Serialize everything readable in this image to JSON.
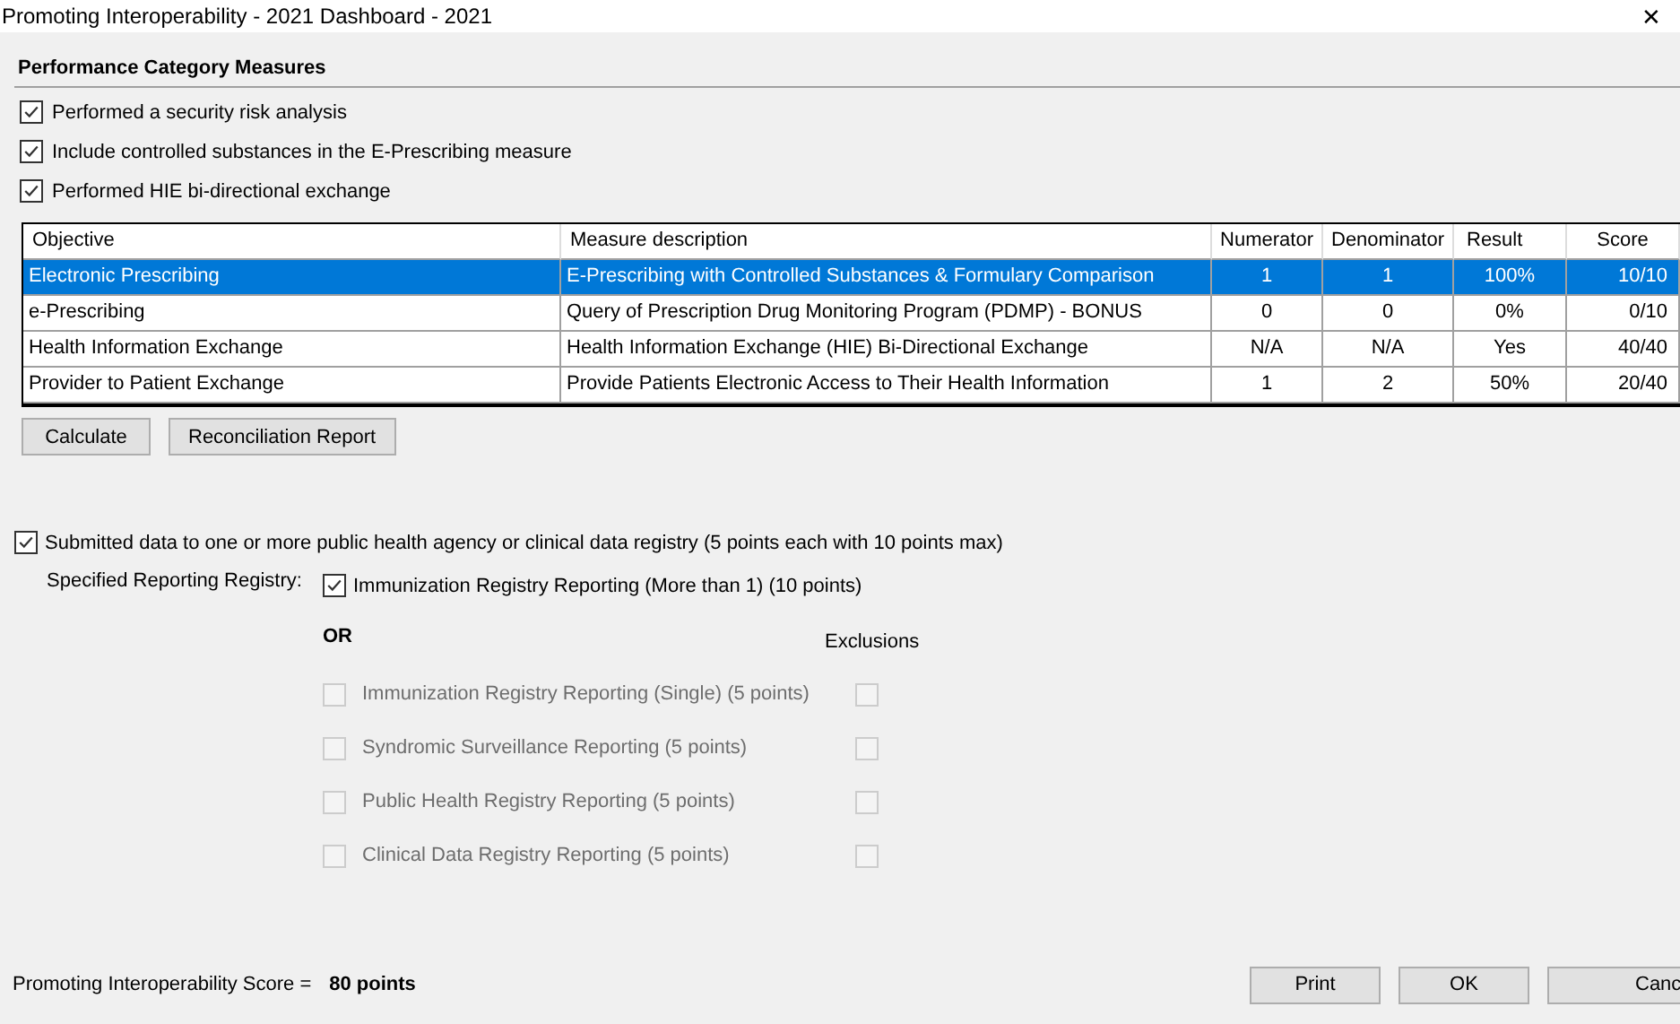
{
  "window": {
    "title": "Promoting Interoperability - 2021 Dashboard - 2021",
    "close": "✕"
  },
  "section_title": "Performance Category Measures",
  "options": [
    {
      "label": "Performed a security risk analysis",
      "checked": true
    },
    {
      "label": "Include controlled substances in the E-Prescribing measure",
      "checked": true
    },
    {
      "label": "Performed HIE bi-directional exchange",
      "checked": true
    }
  ],
  "table": {
    "columns": [
      "Objective",
      "Measure description",
      "Numerator",
      "Denominator",
      "Result",
      "Score"
    ],
    "rows": [
      {
        "cells": [
          "Electronic Prescribing",
          "E-Prescribing with Controlled Substances & Formulary Comparison",
          "1",
          "1",
          "100%",
          "10/10"
        ],
        "selected": true
      },
      {
        "cells": [
          "e-Prescribing",
          "Query of Prescription Drug Monitoring Program (PDMP) - BONUS",
          "0",
          "0",
          "0%",
          "0/10"
        ],
        "selected": false
      },
      {
        "cells": [
          "Health Information Exchange",
          "Health Information Exchange (HIE) Bi-Directional Exchange",
          "N/A",
          "N/A",
          "Yes",
          "40/40"
        ],
        "selected": false
      },
      {
        "cells": [
          "Provider to Patient Exchange",
          "Provide Patients Electronic Access to Their Health Information",
          "1",
          "2",
          "50%",
          "20/40"
        ],
        "selected": false
      }
    ]
  },
  "table_buttons": [
    "Calculate",
    "Reconciliation Report"
  ],
  "public_health": {
    "label": "Submitted data to one or more public health agency or clinical data registry  (5 points each with 10 points max)",
    "checked": true
  },
  "registry_label": "Specified Reporting Registry:",
  "primary_registry": {
    "label": "Immunization Registry Reporting (More than 1) (10 points)",
    "checked": true,
    "disabled": false
  },
  "or_label": "OR",
  "exclusions_label": "Exclusions",
  "registry_options": [
    {
      "label": "Immunization Registry Reporting (Single) (5 points)",
      "checked": false,
      "disabled": true,
      "exclusion_checked": false
    },
    {
      "label": "Syndromic Surveillance Reporting (5 points)",
      "checked": false,
      "disabled": true,
      "exclusion_checked": false
    },
    {
      "label": "Public Health Registry Reporting (5 points)",
      "checked": false,
      "disabled": true,
      "exclusion_checked": false
    },
    {
      "label": "Clinical Data Registry Reporting (5 points)",
      "checked": false,
      "disabled": true,
      "exclusion_checked": false
    }
  ],
  "score_label": "Promoting Interoperability Score =",
  "score_value": "80 points",
  "footer_buttons": [
    "Print",
    "OK",
    "Canc"
  ]
}
